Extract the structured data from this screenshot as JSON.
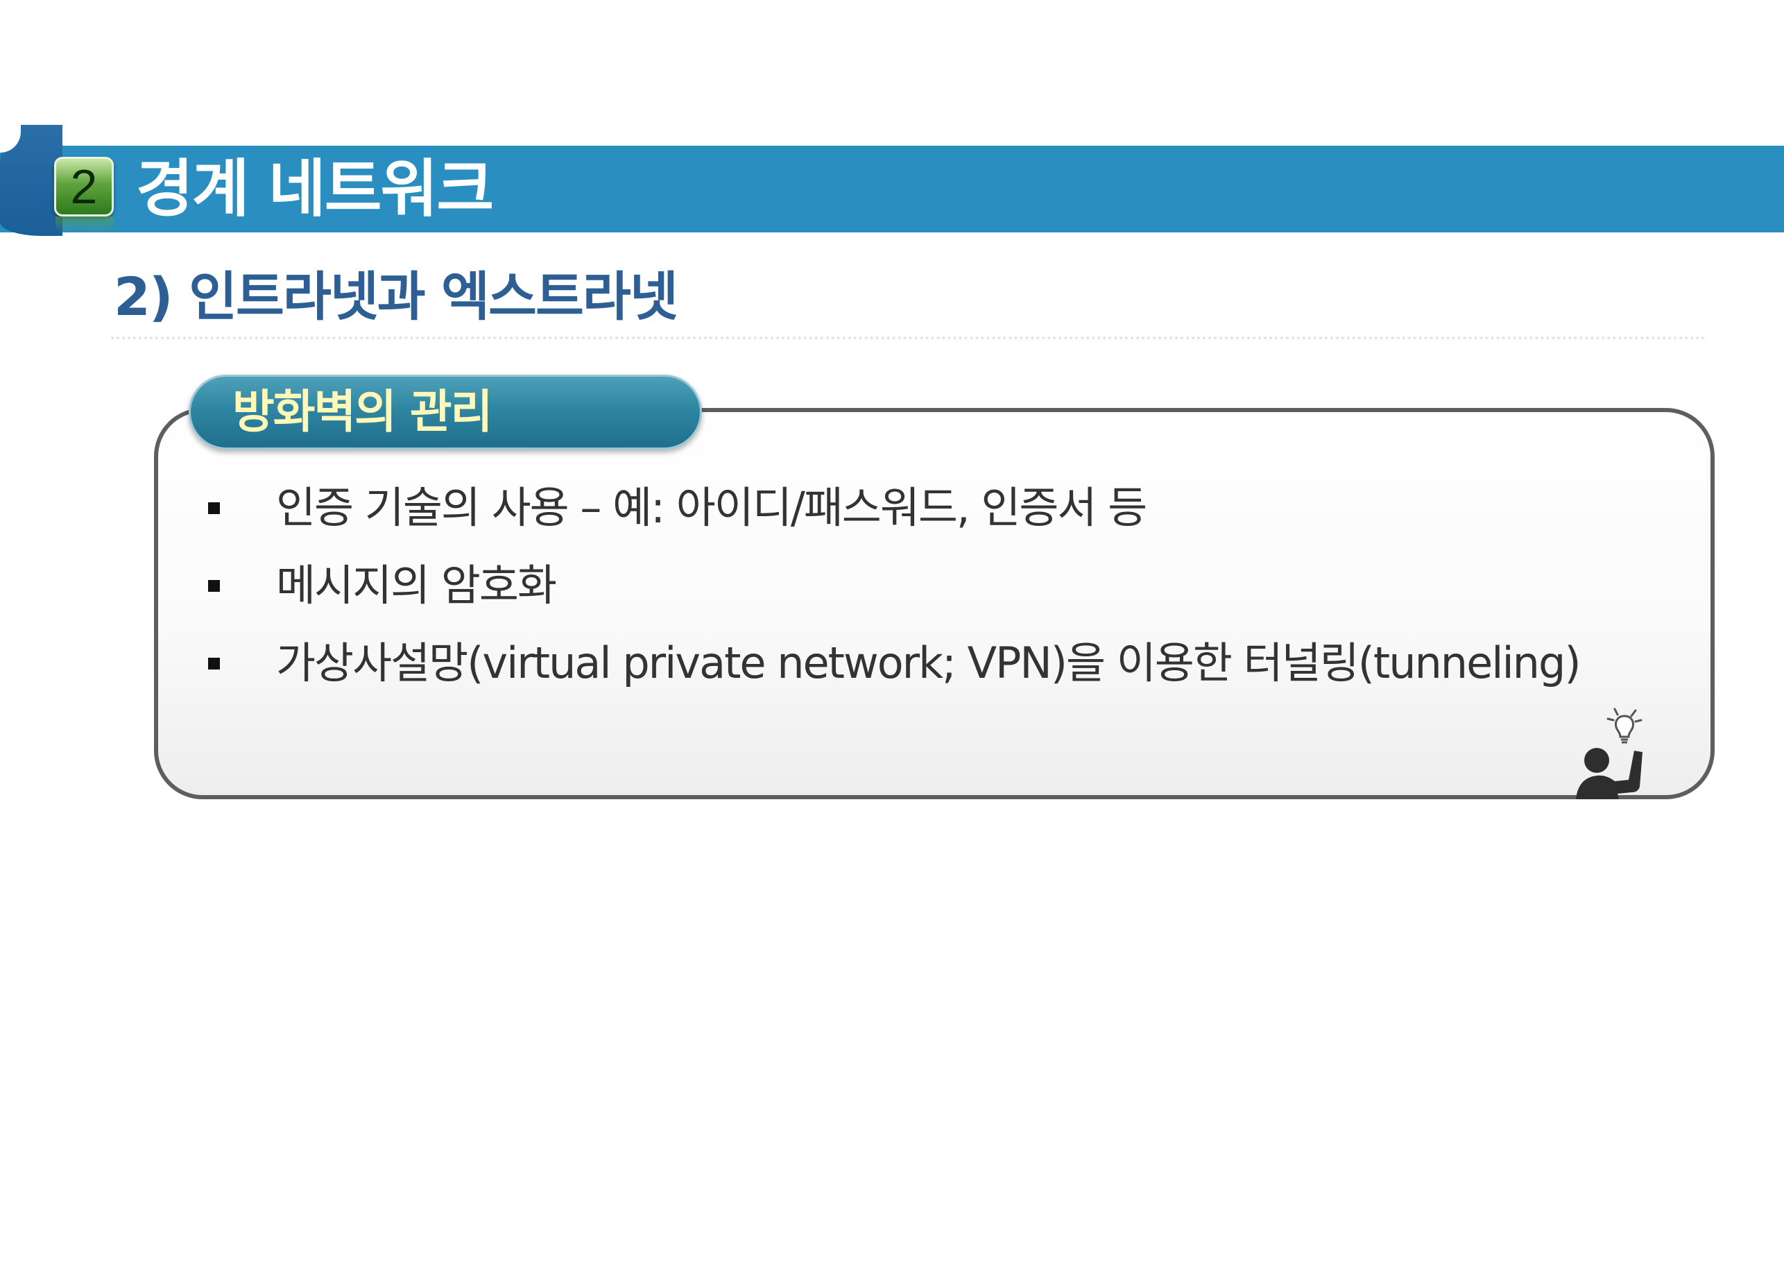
{
  "header": {
    "section_number": "2",
    "title": "경계 네트워크"
  },
  "subtitle": "2) 인트라넷과 엑스트라넷",
  "box": {
    "tab_label": "방화벽의 관리",
    "bullets": [
      "인증 기술의 사용 – 예: 아이디/패스워드, 인증서 등",
      "메시지의 암호화",
      "가상사설망(virtual private network; VPN)을 이용한 터널링(tunneling)"
    ],
    "decoration_icon": "person-idea-icon"
  },
  "colors": {
    "header_band": "#2a8ec0",
    "subtitle": "#2e5f94",
    "tab": "#2f86a2",
    "tab_text": "#fff8b8",
    "box_border": "#5e5e5e"
  }
}
